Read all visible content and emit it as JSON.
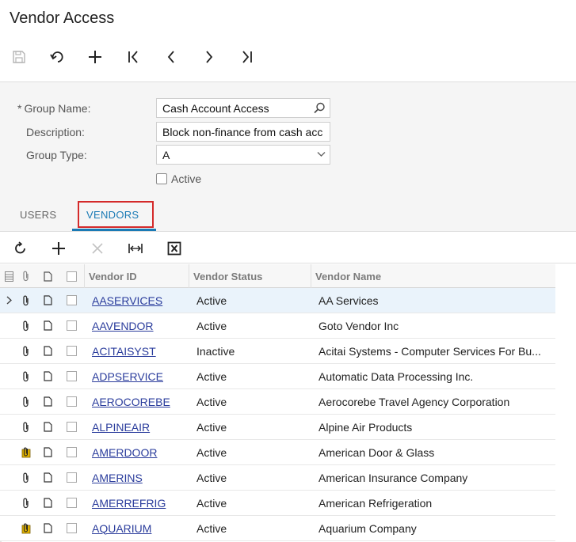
{
  "page": {
    "title": "Vendor Access"
  },
  "form": {
    "group_name_label": "Group Name:",
    "group_name_required_mark": "*",
    "group_name_value": "Cash Account Access",
    "description_label": "Description:",
    "description_value": "Block non-finance from cash acc",
    "group_type_label": "Group Type:",
    "group_type_value": "A",
    "active_label": "Active",
    "active_checked": false
  },
  "tabs": {
    "users": "USERS",
    "vendors": "VENDORS",
    "active": "vendors"
  },
  "grid": {
    "columns": {
      "vendor_id": "Vendor ID",
      "vendor_status": "Vendor Status",
      "vendor_name": "Vendor Name"
    },
    "rows": [
      {
        "id": "AASERVICES",
        "status": "Active",
        "name": "AA Services",
        "attach": "paperclip",
        "selected": true
      },
      {
        "id": "AAVENDOR",
        "status": "Active",
        "name": "Goto Vendor Inc",
        "attach": "paperclip",
        "selected": false
      },
      {
        "id": "ACITAISYST",
        "status": "Inactive",
        "name": "Acitai Systems - Computer Services For Bu...",
        "attach": "paperclip",
        "selected": false
      },
      {
        "id": "ADPSERVICE",
        "status": "Active",
        "name": "Automatic Data Processing Inc.",
        "attach": "paperclip",
        "selected": false
      },
      {
        "id": "AEROCOREBE",
        "status": "Active",
        "name": "Aerocorebe Travel Agency Corporation",
        "attach": "paperclip",
        "selected": false
      },
      {
        "id": "ALPINEAIR",
        "status": "Active",
        "name": "Alpine Air Products",
        "attach": "paperclip",
        "selected": false
      },
      {
        "id": "AMERDOOR",
        "status": "Active",
        "name": "American Door & Glass",
        "attach": "paperclip-note",
        "selected": false
      },
      {
        "id": "AMERINS",
        "status": "Active",
        "name": "American Insurance Company",
        "attach": "paperclip",
        "selected": false
      },
      {
        "id": "AMERREFRIG",
        "status": "Active",
        "name": "American Refrigeration",
        "attach": "paperclip",
        "selected": false
      },
      {
        "id": "AQUARIUM",
        "status": "Active",
        "name": "Aquarium Company",
        "attach": "paperclip-note",
        "selected": false
      }
    ]
  },
  "colors": {
    "accent": "#1a7ab5",
    "highlight_box": "#d42a2a",
    "link": "#2a3c9c",
    "selected_row": "#eaf3fb"
  }
}
